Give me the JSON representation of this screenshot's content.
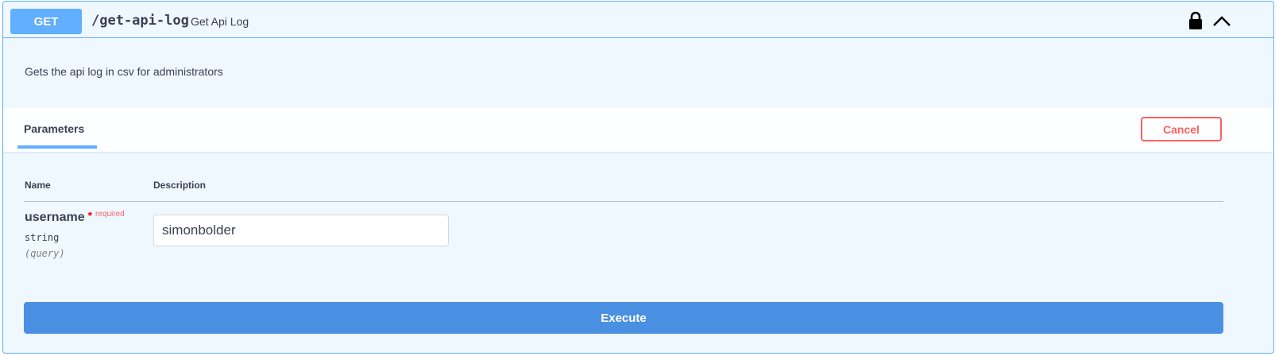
{
  "summary": {
    "method": "GET",
    "path": "/get-api-log",
    "short_description": "Get Api Log"
  },
  "description": "Gets the api log in csv for administrators",
  "tabs": {
    "parameters_label": "Parameters",
    "cancel_label": "Cancel"
  },
  "table": {
    "col_name": "Name",
    "col_description": "Description"
  },
  "parameter": {
    "name": "username",
    "required_marker": "*",
    "required_label": "required",
    "type": "string",
    "in": "(query)",
    "value": "simonbolder"
  },
  "execute_label": "Execute",
  "colors": {
    "method_bg": "#61affe",
    "block_bg": "#eff7ff",
    "cancel": "#ff6060",
    "execute_bg": "#4990e2"
  },
  "icons": {
    "lock": "lock-icon",
    "collapse": "chevron-up-icon"
  }
}
